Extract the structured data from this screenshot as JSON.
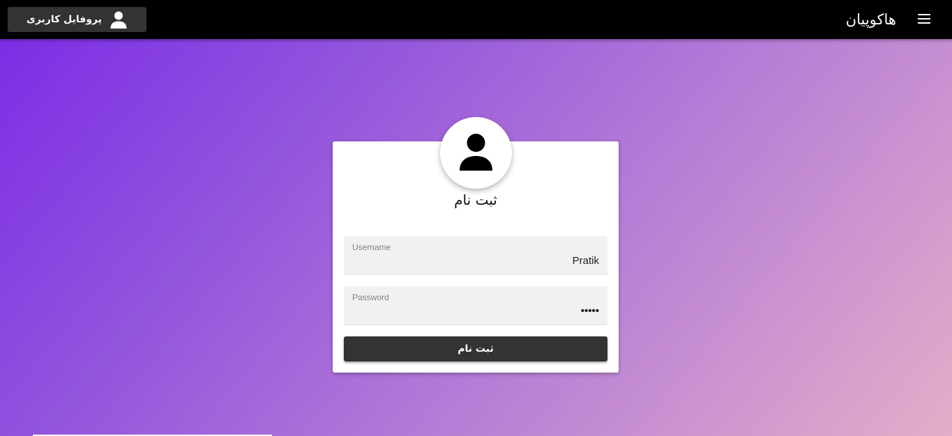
{
  "header": {
    "app_title": "هاکوپیان",
    "profile_button_label": "پروفایل کاربری",
    "menu_icon": "menu-icon",
    "profile_icon": "person-icon"
  },
  "card": {
    "avatar_icon": "person-icon",
    "title": "ثبت نام",
    "username": {
      "label": "Username",
      "value": "Pratik"
    },
    "password": {
      "label": "Password",
      "value": "•••••"
    },
    "submit_label": "ثبت نام"
  },
  "colors": {
    "app_bar": "#000000",
    "button": "#333333",
    "gradient_start": "#7a2ae6",
    "gradient_end": "#e3aec8",
    "field_bg": "#f1f1f1"
  }
}
